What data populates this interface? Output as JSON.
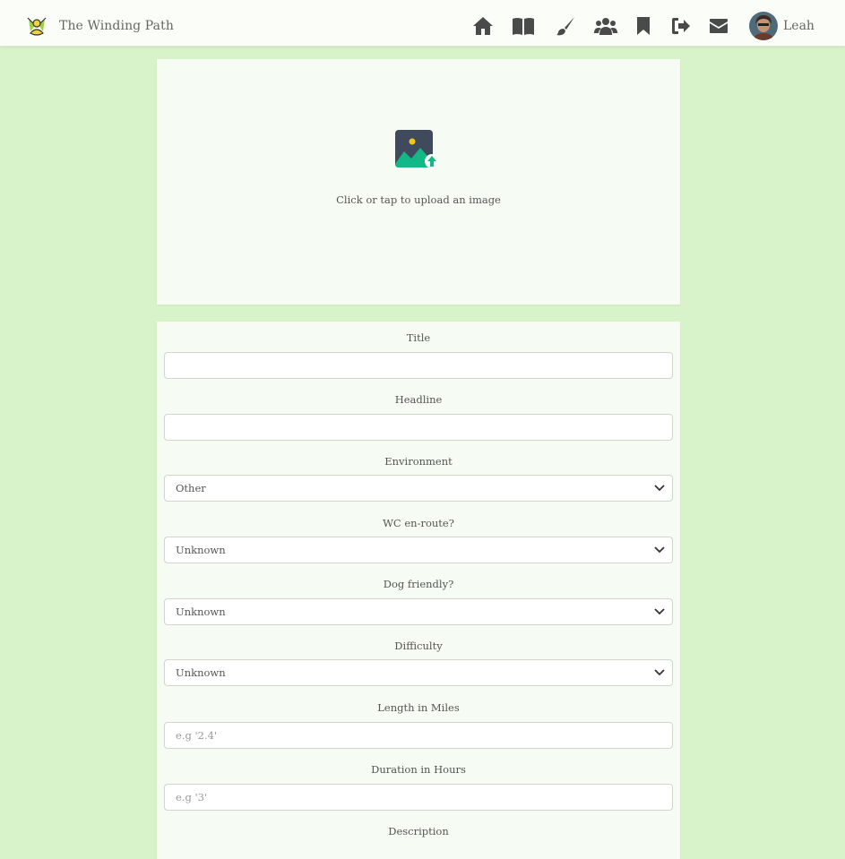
{
  "brand": {
    "name": "The Winding Path",
    "logo_icon": "winding-path-logo-icon"
  },
  "nav": {
    "icons": [
      "home-icon",
      "book-icon",
      "brush-icon",
      "users-icon",
      "bookmark-icon",
      "sign-out-icon",
      "envelope-icon"
    ],
    "user_name": "Leah"
  },
  "upload": {
    "prompt": "Click or tap to upload an image",
    "icon": "image-upload-icon"
  },
  "form": {
    "title_label": "Title",
    "title_value": "",
    "headline_label": "Headline",
    "headline_value": "",
    "environment_label": "Environment",
    "environment_value": "Other",
    "wc_label": "WC en-route?",
    "wc_value": "Unknown",
    "dog_label": "Dog friendly?",
    "dog_value": "Unknown",
    "difficulty_label": "Difficulty",
    "difficulty_value": "Unknown",
    "length_label": "Length in Miles",
    "length_placeholder": "e.g '2.4'",
    "duration_label": "Duration in Hours",
    "duration_placeholder": "e.g '3'",
    "description_label": "Description"
  },
  "colors": {
    "page_background": "#d8f3c9",
    "card_background": "#f6fbf3",
    "upload_icon_dark": "#3f4a5c",
    "upload_icon_green": "#12b886",
    "upload_icon_sun": "#f5c518"
  }
}
